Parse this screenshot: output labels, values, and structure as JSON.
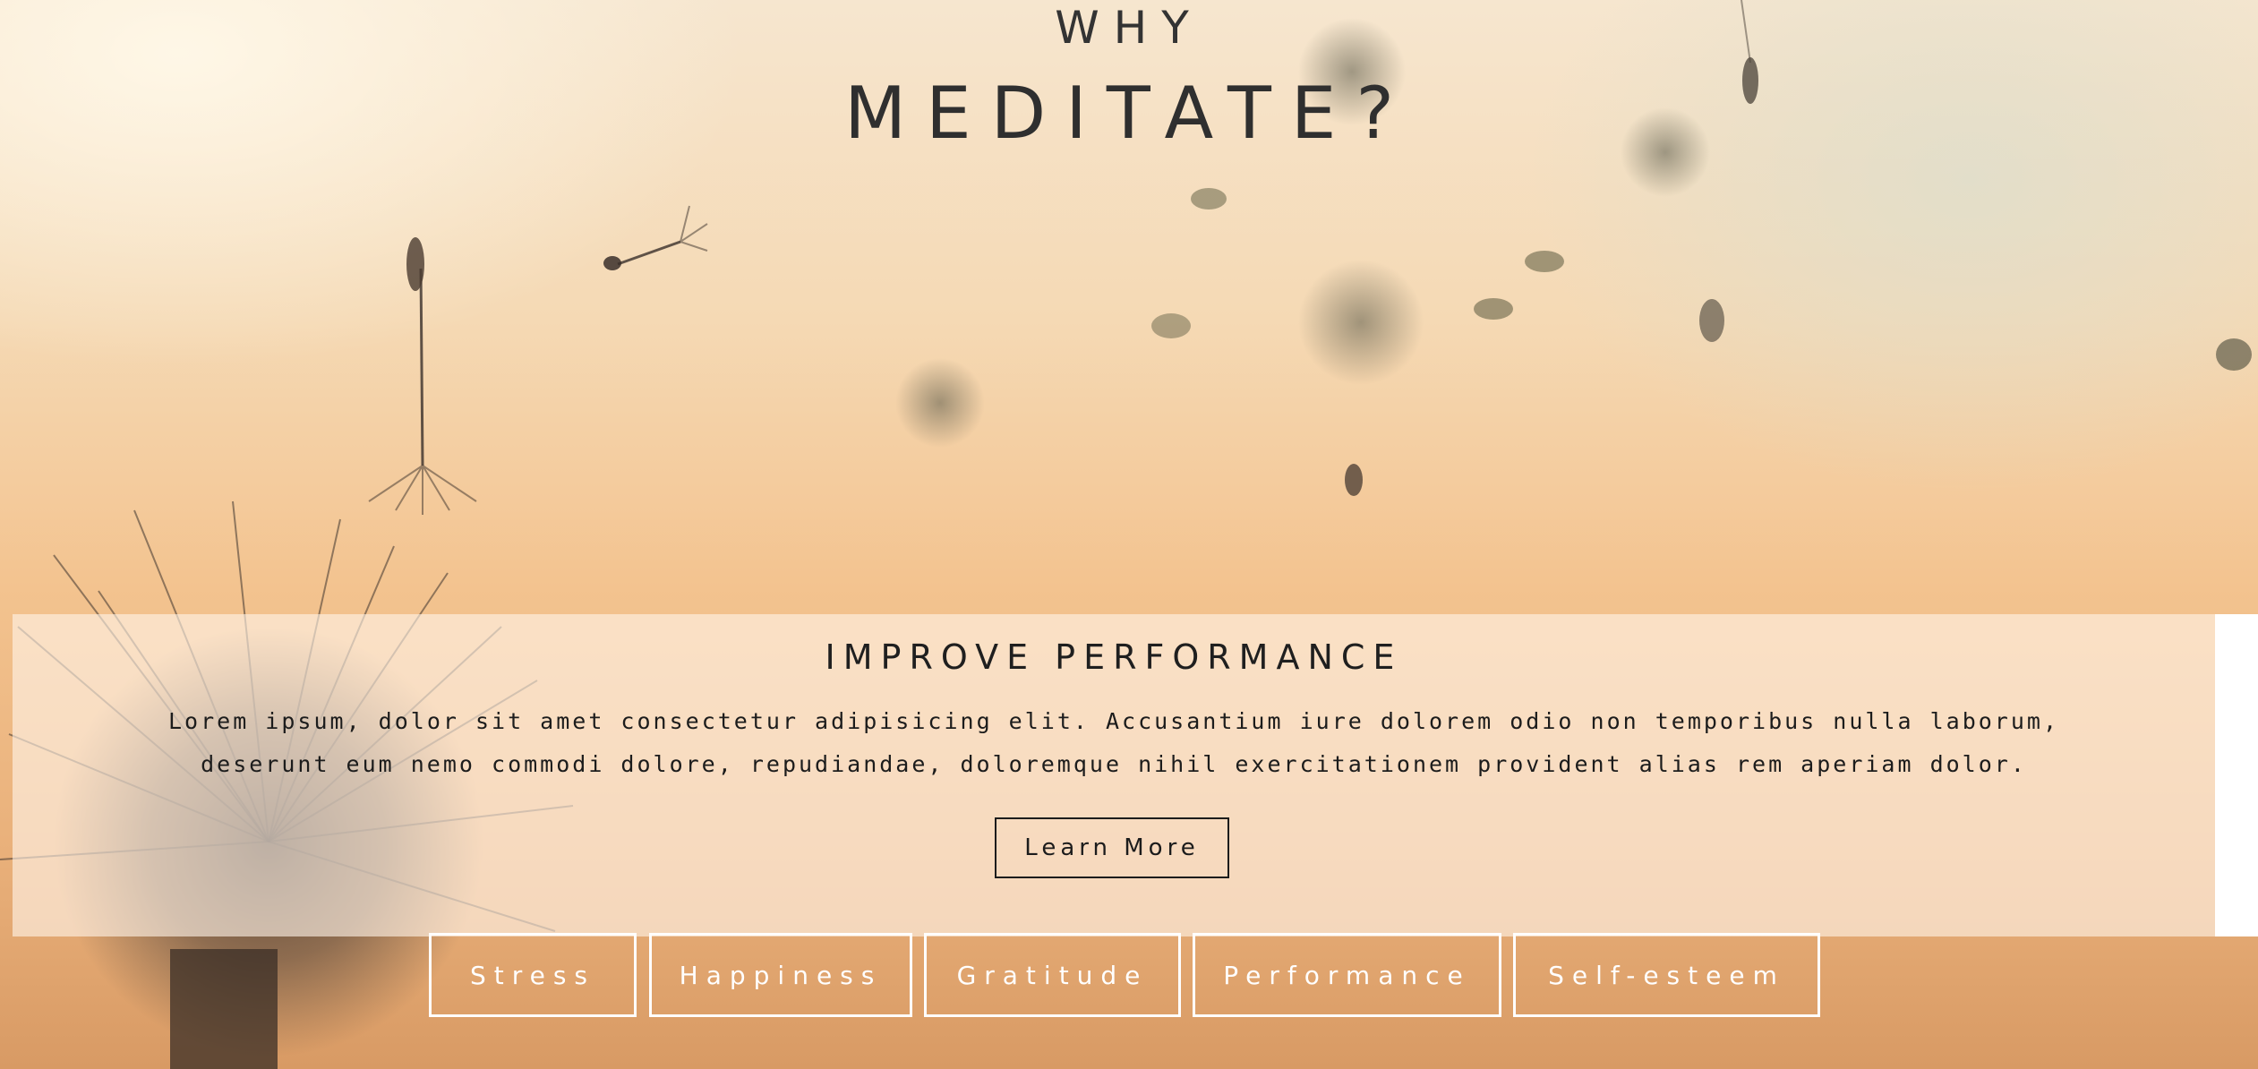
{
  "hero": {
    "line1": "WHY",
    "line2": "MEDITATE?"
  },
  "section": {
    "heading": "IMPROVE PERFORMANCE",
    "body": "Lorem ipsum, dolor sit amet consectetur adipisicing elit. Accusantium iure dolorem odio non temporibus nulla laborum, deserunt eum nemo commodi dolore, repudiandae, doloremque nihil exercitationem provident alias rem aperiam dolor.",
    "button_label": "Learn More"
  },
  "tabs": [
    {
      "label": "Stress",
      "active": true
    },
    {
      "label": "Happiness",
      "active": false
    },
    {
      "label": "Gratitude",
      "active": false
    },
    {
      "label": "Performance",
      "active": false
    },
    {
      "label": "Self-esteem",
      "active": false
    }
  ],
  "colors": {
    "text_dark": "#2b2b2b",
    "tab_border": "#ffffff",
    "panel_bg": "#fff4e8"
  }
}
